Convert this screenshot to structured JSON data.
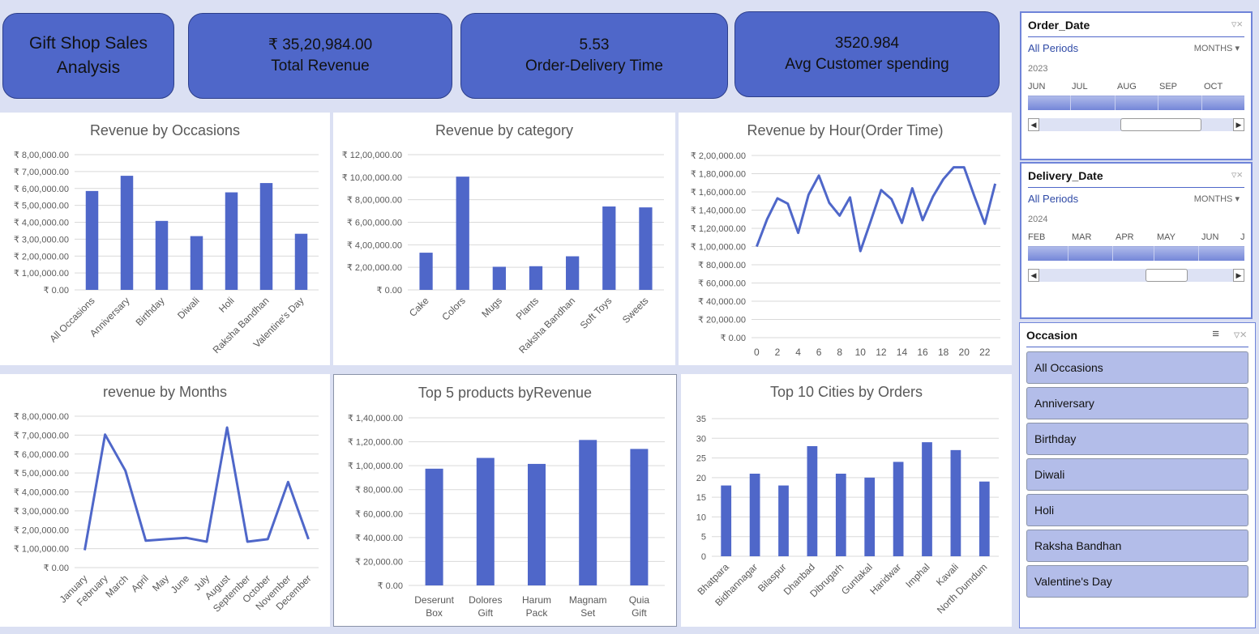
{
  "kpis": {
    "title_line1": "Gift Shop Sales",
    "title_line2": "Analysis",
    "revenue_value": "₹ 35,20,984.00",
    "revenue_label": "Total Revenue",
    "delivery_value": "5.53",
    "delivery_label": "Order-Delivery Time",
    "spending_value": "3520.984",
    "spending_label": "Avg Customer spending"
  },
  "order_date_slicer": {
    "header": "Order_Date",
    "periods": "All Periods",
    "unit": "MONTHS",
    "year": "2023",
    "months": [
      "JUN",
      "JUL",
      "AUG",
      "SEP",
      "OCT"
    ]
  },
  "delivery_date_slicer": {
    "header": "Delivery_Date",
    "periods": "All Periods",
    "unit": "MONTHS",
    "year": "2024",
    "months": [
      "FEB",
      "MAR",
      "APR",
      "MAY",
      "JUN",
      "J"
    ]
  },
  "occasion_slicer": {
    "header": "Occasion",
    "items": [
      "All Occasions",
      "Anniversary",
      "Birthday",
      "Diwali",
      "Holi",
      "Raksha Bandhan",
      "Valentine's Day"
    ]
  },
  "colors": {
    "bar": "#4f67c9",
    "kpi_bg": "#4f67c9",
    "page_bg": "#dbe0f3",
    "slicer_item": "#b3bde9"
  },
  "icons": {
    "clear_filter": "clear-filter-icon",
    "multi_select": "multi-select-icon"
  },
  "chart_data": [
    {
      "id": "occasions",
      "type": "bar",
      "title": "Revenue by Occasions",
      "categories": [
        "All Occasions",
        "Anniversary",
        "Birthday",
        "Diwali",
        "Holi",
        "Raksha Bandhan",
        "Valentine's Day"
      ],
      "values": [
        585000,
        675000,
        408000,
        318000,
        577000,
        632000,
        332000
      ],
      "ylim": [
        0,
        800000
      ],
      "ticks": [
        "₹ 0.00",
        "₹ 1,00,000.00",
        "₹ 2,00,000.00",
        "₹ 3,00,000.00",
        "₹ 4,00,000.00",
        "₹ 5,00,000.00",
        "₹ 6,00,000.00",
        "₹ 7,00,000.00",
        "₹ 8,00,000.00"
      ],
      "grid": true,
      "rotate": true
    },
    {
      "id": "category",
      "type": "bar",
      "title": "Revenue by category",
      "categories": [
        "Cake",
        "Colors",
        "Mugs",
        "Plants",
        "Raksha Bandhan",
        "Soft Toys",
        "Sweets"
      ],
      "values": [
        330000,
        1005000,
        205000,
        210000,
        298000,
        740000,
        732000
      ],
      "ylim": [
        0,
        1200000
      ],
      "ticks": [
        "₹ 0.00",
        "₹ 2,00,000.00",
        "₹ 4,00,000.00",
        "₹ 6,00,000.00",
        "₹ 8,00,000.00",
        "₹ 10,00,000.00",
        "₹ 12,00,000.00"
      ],
      "grid": true,
      "rotate": true
    },
    {
      "id": "hour",
      "type": "line",
      "title": "Revenue by Hour(Order Time)",
      "categories": [
        "0",
        "1",
        "2",
        "3",
        "4",
        "5",
        "6",
        "7",
        "8",
        "9",
        "10",
        "11",
        "12",
        "13",
        "14",
        "15",
        "16",
        "17",
        "18",
        "19",
        "20",
        "21",
        "22",
        "23"
      ],
      "tick_labels": [
        "0",
        "",
        "2",
        "",
        "4",
        "",
        "6",
        "",
        "8",
        "",
        "10",
        "",
        "12",
        "",
        "14",
        "",
        "16",
        "",
        "18",
        "",
        "20",
        "",
        "22",
        ""
      ],
      "values": [
        100000,
        130000,
        153000,
        147000,
        115000,
        157000,
        178000,
        148000,
        134000,
        154000,
        95000,
        128000,
        162000,
        152000,
        126000,
        164000,
        129000,
        155000,
        174000,
        187000,
        187000,
        155000,
        125000,
        169000
      ],
      "ylim": [
        0,
        200000
      ],
      "ticks": [
        "₹ 0.00",
        "₹ 20,000.00",
        "₹ 40,000.00",
        "₹ 60,000.00",
        "₹ 80,000.00",
        "₹ 1,00,000.00",
        "₹ 1,20,000.00",
        "₹ 1,40,000.00",
        "₹ 1,60,000.00",
        "₹ 1,80,000.00",
        "₹ 2,00,000.00"
      ],
      "grid": true,
      "rotate": false
    },
    {
      "id": "months",
      "type": "line",
      "title": "revenue by Months",
      "categories": [
        "January",
        "February",
        "March",
        "April",
        "May",
        "June",
        "July",
        "August",
        "September",
        "October",
        "November",
        "December"
      ],
      "values": [
        92000,
        703000,
        512000,
        142000,
        150000,
        157000,
        137000,
        740000,
        137000,
        150000,
        452000,
        150000
      ],
      "ylim": [
        0,
        800000
      ],
      "ticks": [
        "₹ 0.00",
        "₹ 1,00,000.00",
        "₹ 2,00,000.00",
        "₹ 3,00,000.00",
        "₹ 4,00,000.00",
        "₹ 5,00,000.00",
        "₹ 6,00,000.00",
        "₹ 7,00,000.00",
        "₹ 8,00,000.00"
      ],
      "grid": true,
      "rotate": true
    },
    {
      "id": "products",
      "type": "bar",
      "title": "Top 5 products byRevenue",
      "categories": [
        "Deserunt Box",
        "Dolores Gift",
        "Harum Pack",
        "Magnam Set",
        "Quia Gift"
      ],
      "values": [
        97500,
        106500,
        101500,
        121500,
        114000
      ],
      "ylim": [
        0,
        140000
      ],
      "ticks": [
        "₹ 0.00",
        "₹ 20,000.00",
        "₹ 40,000.00",
        "₹ 60,000.00",
        "₹ 80,000.00",
        "₹ 1,00,000.00",
        "₹ 1,20,000.00",
        "₹ 1,40,000.00"
      ],
      "grid": true,
      "rotate": false
    },
    {
      "id": "cities",
      "type": "bar",
      "title": "Top 10 Cities by Orders",
      "categories": [
        "Bhatpara",
        "Bidhannagar",
        "Bilaspur",
        "Dhanbad",
        "Dibrugarh",
        "Guntakal",
        "Haridwar",
        "Imphal",
        "Kavali",
        "North Dumdum"
      ],
      "values": [
        18,
        21,
        18,
        28,
        21,
        20,
        24,
        29,
        27,
        19
      ],
      "ylim": [
        0,
        35
      ],
      "ticks": [
        "0",
        "5",
        "10",
        "15",
        "20",
        "25",
        "30",
        "35"
      ],
      "grid": true,
      "rotate": true
    }
  ]
}
